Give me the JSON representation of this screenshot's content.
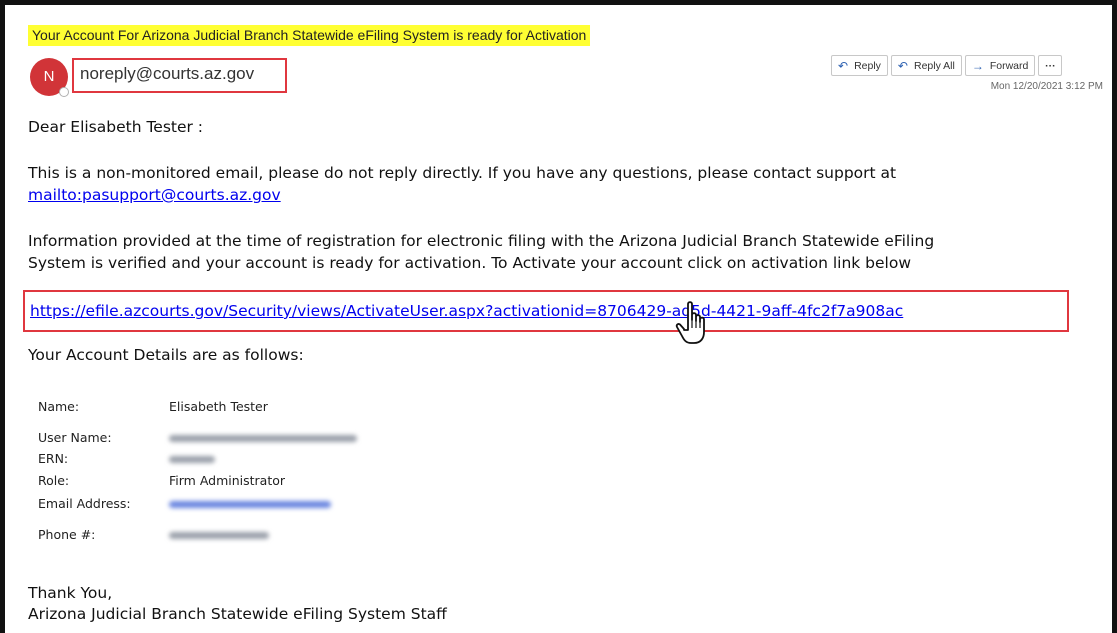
{
  "email": {
    "subject": "Your Account For Arizona Judicial Branch Statewide eFiling System is ready for Activation",
    "avatar_initial": "N",
    "sender": "noreply@courts.az.gov",
    "date": "Mon 12/20/2021 3:12 PM",
    "actions": {
      "reply": "Reply",
      "reply_all": "Reply All",
      "forward": "Forward",
      "more": "···"
    }
  },
  "body": {
    "greeting": "Dear Elisabeth Tester :",
    "notice_line1": "This is a non-monitored email, please do not reply directly. If you have any questions, please contact support at",
    "support_link": "mailto:pasupport@courts.az.gov",
    "info_line1": "Information provided at the time of registration for electronic filing with the Arizona Judicial Branch Statewide eFiling",
    "info_line2": "System is verified and your account is ready for activation. To Activate your account click on activation link below",
    "activation_link": "https://efile.azcourts.gov/Security/views/ActivateUser.aspx?activationid=8706429-ad5d-4421-9aff-4fc2f7a908ac",
    "details_heading": "Your Account Details are as follows:",
    "details": [
      {
        "label": "Name:",
        "value": "Elisabeth Tester",
        "redacted": false
      },
      {
        "label": "User Name:",
        "value": "",
        "redacted": true
      },
      {
        "label": "ERN:",
        "value": "",
        "redacted": true
      },
      {
        "label": "Role:",
        "value": "Firm Administrator",
        "redacted": false
      },
      {
        "label": "Email Address:",
        "value": "",
        "redacted": true
      },
      {
        "label": "Phone #:",
        "value": "",
        "redacted": true
      }
    ],
    "closing": "Thank You,",
    "signature": "Arizona Judicial Branch Statewide eFiling System Staff"
  },
  "colors": {
    "highlight": "#ffff33",
    "annotation_box": "#e0373f",
    "avatar": "#d13438",
    "link": "#0000ee"
  }
}
